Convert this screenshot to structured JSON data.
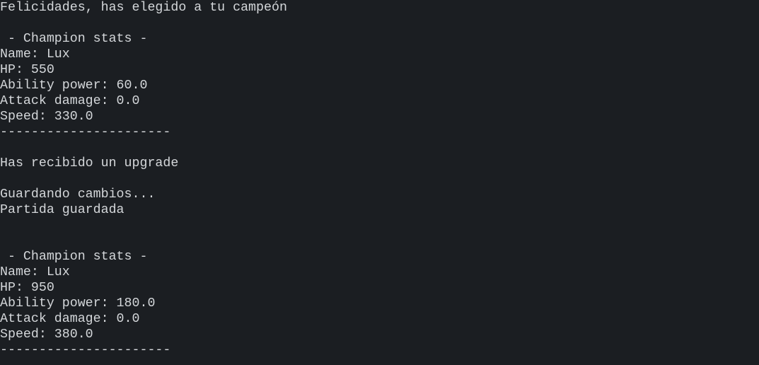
{
  "terminal": {
    "lines": [
      "Felicidades, has elegido a tu campeón",
      "",
      " - Champion stats -",
      "Name: Lux",
      "HP: 550",
      "Ability power: 60.0",
      "Attack damage: 0.0",
      "Speed: 330.0",
      "----------------------",
      "",
      "Has recibido un upgrade",
      "",
      "Guardando cambios...",
      "Partida guardada",
      "",
      "",
      " - Champion stats -",
      "Name: Lux",
      "HP: 950",
      "Ability power: 180.0",
      "Attack damage: 0.0",
      "Speed: 380.0",
      "----------------------"
    ]
  }
}
